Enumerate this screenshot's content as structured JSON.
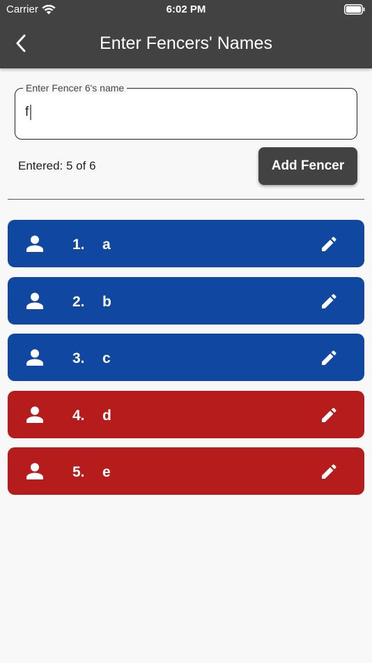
{
  "status": {
    "carrier": "Carrier",
    "time": "6:02 PM"
  },
  "header": {
    "title": "Enter Fencers' Names",
    "back_icon": "chevron-left-icon"
  },
  "input": {
    "label": "Enter Fencer 6's name",
    "value": "f"
  },
  "progress": {
    "text": "Entered: 5 of 6",
    "entered": 5,
    "total": 6
  },
  "add_button": {
    "label": "Add Fencer"
  },
  "colors": {
    "appbar": "#424242",
    "blue": "#0f47a1",
    "red": "#b71c1c",
    "background": "#f8f8f8"
  },
  "fencers": [
    {
      "number": "1.",
      "name": "a",
      "team": "blue"
    },
    {
      "number": "2.",
      "name": "b",
      "team": "blue"
    },
    {
      "number": "3.",
      "name": "c",
      "team": "blue"
    },
    {
      "number": "4.",
      "name": "d",
      "team": "red"
    },
    {
      "number": "5.",
      "name": "e",
      "team": "red"
    }
  ]
}
